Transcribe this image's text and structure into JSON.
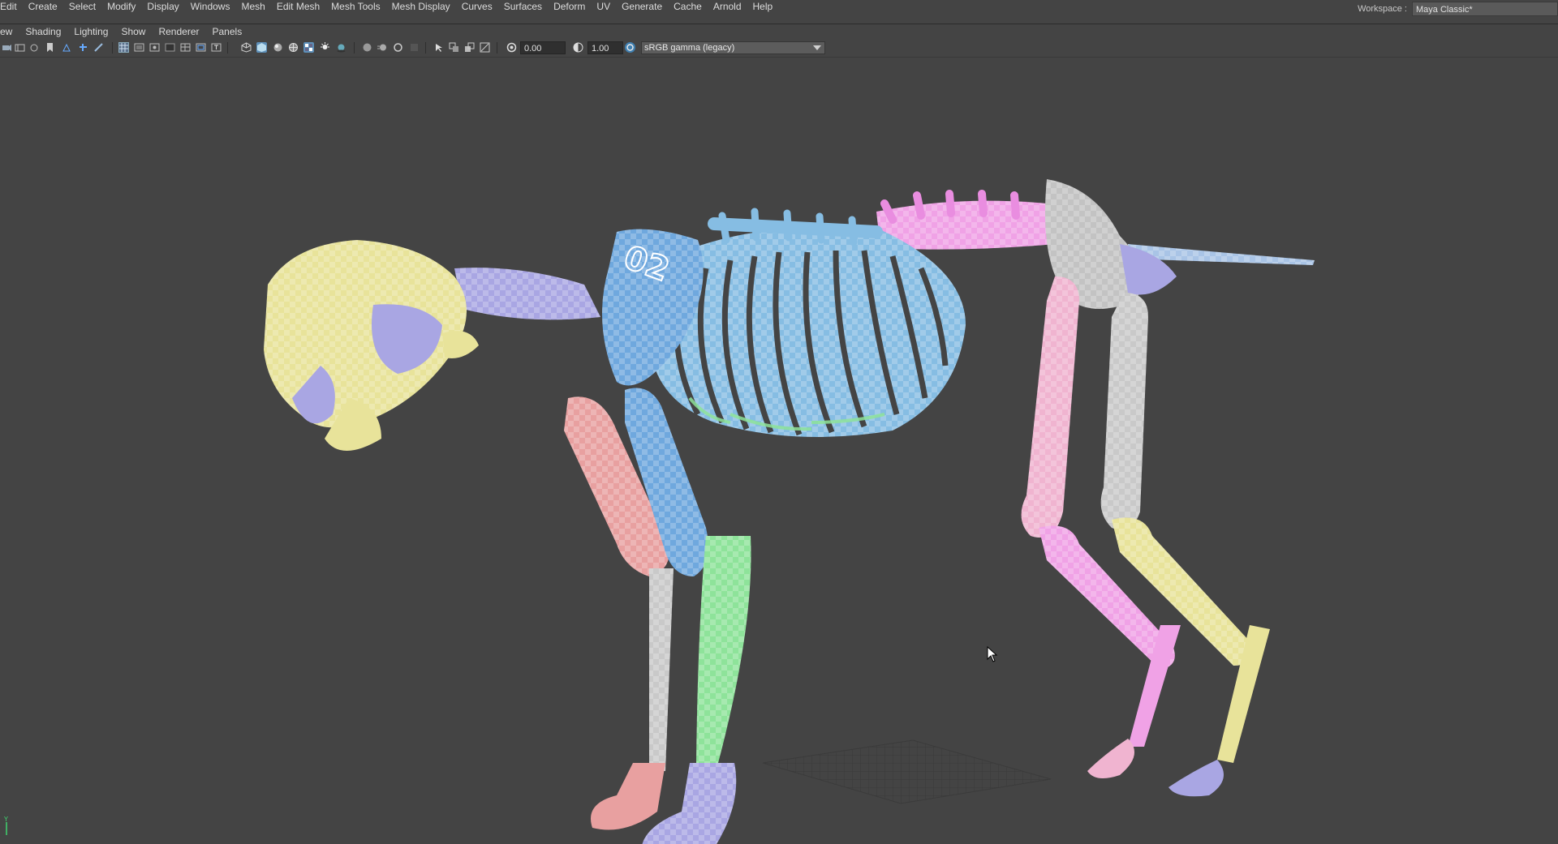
{
  "menubar": {
    "items": [
      "Edit",
      "Create",
      "Select",
      "Modify",
      "Display",
      "Windows",
      "Mesh",
      "Edit Mesh",
      "Mesh Tools",
      "Mesh Display",
      "Curves",
      "Surfaces",
      "Deform",
      "UV",
      "Generate",
      "Cache",
      "Arnold",
      "Help"
    ],
    "workspace_label": "Workspace :",
    "workspace_value": "Maya Classic*"
  },
  "panel_menu": {
    "items": [
      "ew",
      "Shading",
      "Lighting",
      "Show",
      "Renderer",
      "Panels"
    ]
  },
  "toolbar": {
    "exposure_value": "0.00",
    "gamma_value": "1.00",
    "color_space": "sRGB gamma (legacy)",
    "icons": [
      "camera-icon",
      "film-icon",
      "bookmark-icon",
      "grid-icon",
      "resolution-gate-icon",
      "wireframe-icon",
      "smooth-shade-icon",
      "textured-icon",
      "lights-icon",
      "shadows-icon",
      "isolate-icon",
      "xray-icon",
      "exposure-icon",
      "gamma-icon",
      "color-management-icon"
    ]
  },
  "viewport": {
    "axis_label": "Y",
    "scene_description_colors": [
      "#e8e39a",
      "#a9a6e3",
      "#86bde3",
      "#e8a0a0",
      "#8ee39a",
      "#f0a2e6",
      "#c9c9c9"
    ]
  }
}
